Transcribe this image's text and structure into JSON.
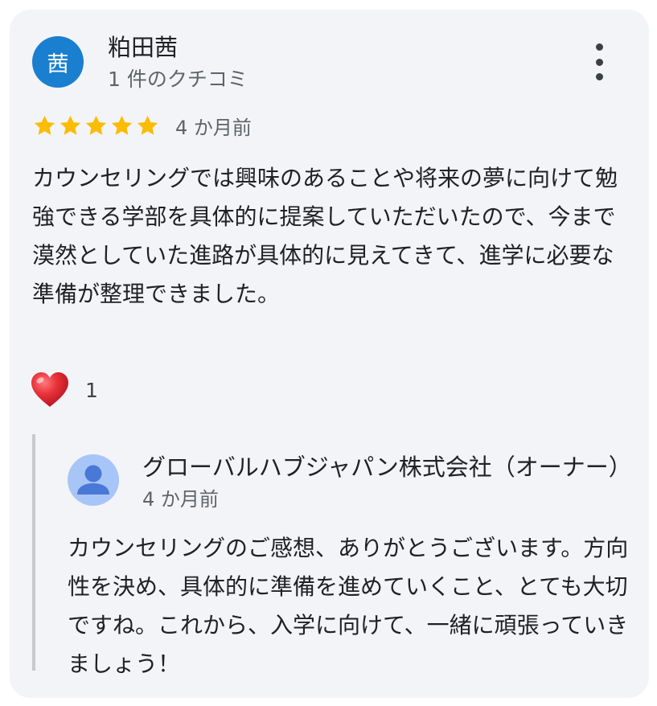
{
  "review": {
    "avatar_initial": "茜",
    "reviewer_name": "粕田茜",
    "review_count": "1 件のクチコミ",
    "rating": 5,
    "rating_max": 5,
    "time": "4 か月前",
    "text": "カウンセリングでは興味のあることや将来の夢に向けて勉強できる学部を具体的に提案していただいたので、今まで漠然としていた進路が具体的に見えてきて、進学に必要な準備が整理できました。",
    "reaction_count": "1"
  },
  "reply": {
    "owner_name": "グローバルハブジャパン株式会社（オーナー）",
    "time": "4 か月前",
    "text": "カウンセリングのご感想、ありがとうございます。方向性を決め、具体的に準備を進めていくこと、とても大切ですね。これから、入学に向けて、一緒に頑張っていきましょう！"
  },
  "icons": {
    "star": "star-icon",
    "more": "more-vert-icon",
    "heart": "heart-icon",
    "owner_avatar": "person-icon"
  },
  "colors": {
    "avatar_bg": "#1a7fcf",
    "star": "#fbbc04",
    "heart": "#e8323a",
    "owner_avatar_bg": "#a8c5f7",
    "owner_avatar_fg": "#4a78d6",
    "card_bg": "#f3f4f7"
  }
}
